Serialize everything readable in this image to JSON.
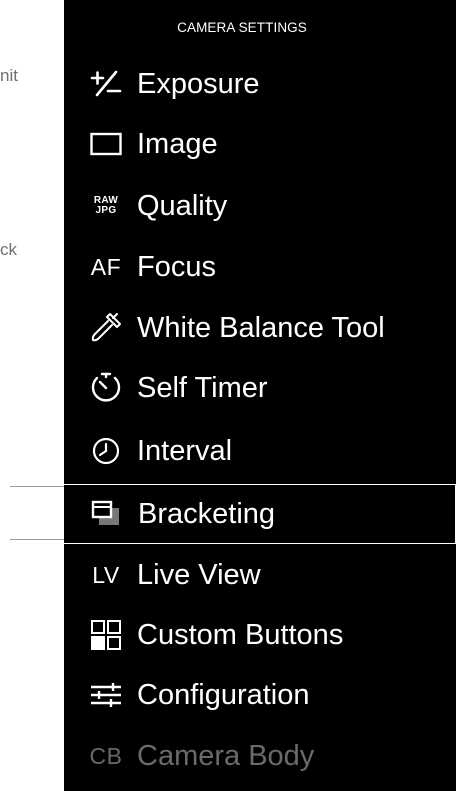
{
  "background_labels": [
    "nit",
    "ck"
  ],
  "panel": {
    "title": "CAMERA SETTINGS",
    "items": [
      {
        "label": "Exposure",
        "icon": "plus-minus-icon"
      },
      {
        "label": "Image",
        "icon": "image-frame-icon"
      },
      {
        "label": "Quality",
        "icon": "raw-jpg-icon",
        "icon_text_top": "RAW",
        "icon_text_bottom": "JPG"
      },
      {
        "label": "Focus",
        "icon": "af-icon",
        "icon_text": "AF"
      },
      {
        "label": "White Balance Tool",
        "icon": "eyedropper-icon"
      },
      {
        "label": "Self Timer",
        "icon": "self-timer-icon"
      },
      {
        "label": "Interval",
        "icon": "clock-icon"
      },
      {
        "label": "Bracketing",
        "icon": "bracketing-icon",
        "selected": true
      },
      {
        "label": "Live View",
        "icon": "lv-icon",
        "icon_text": "LV"
      },
      {
        "label": "Custom Buttons",
        "icon": "custom-buttons-grid-icon"
      },
      {
        "label": "Configuration",
        "icon": "sliders-icon"
      },
      {
        "label": "Camera Body",
        "icon": "cb-icon",
        "icon_text": "CB",
        "disabled": true
      }
    ]
  },
  "colors": {
    "panel_bg": "#000000",
    "text": "#ffffff",
    "disabled_text": "#6a6a6a",
    "selection_border": "#ffffff"
  }
}
